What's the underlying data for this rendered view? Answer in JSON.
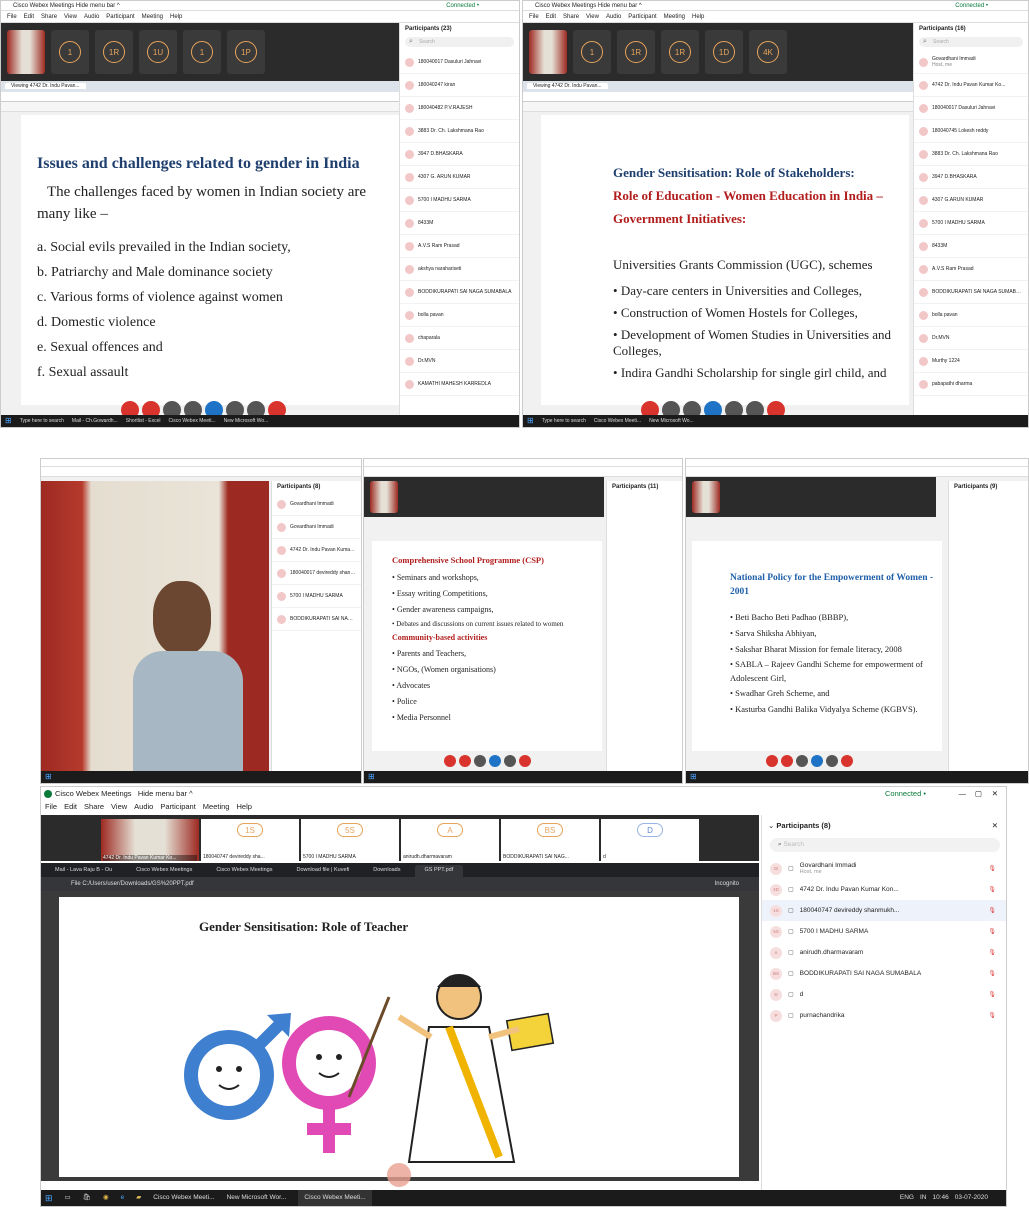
{
  "panel_a": {
    "title": "Cisco Webex Meetings  Hide menu bar ^",
    "connected": "Connected •",
    "menu": [
      "File",
      "Edit",
      "Share",
      "View",
      "Audio",
      "Participant",
      "Meeting",
      "Help"
    ],
    "thumbs": [
      "1",
      "1R",
      "1U",
      "1",
      "1P"
    ],
    "tab": "Viewing 4742 Dr. Indu Pavan...",
    "heading": "Issues and challenges related to gender in India",
    "intro": "The challenges faced by women in Indian society are many like –",
    "items": [
      "a. Social evils prevailed in the Indian society,",
      "b. Patriarchy and Male dominance society",
      "c. Various forms of violence against women",
      "d. Domestic violence",
      "e. Sexual offences and",
      "f. Sexual assault"
    ],
    "participants_header": "Participants (23)",
    "participants": [
      "180040017 Dasuluri Jahnavi",
      "180040247 kiran",
      "180040482 P.V.RAJESH",
      "3883 Dr. Ch. Lakshmana Rao",
      "3947 D.BHASKARA",
      "4307 G. ARUN KUMAR",
      "5700 I MADHU SARMA",
      "8433M",
      "A.V.S Ram Prasad",
      "akshya narahariseti",
      "BODDIKURAPATI SAI NAGA SUMABALA",
      "bolla pavan",
      "chaparala",
      "Dr.MVN",
      "KAMATHI MAHESH KARREDLA"
    ],
    "search": "Search",
    "taskbar": [
      "Type here to search",
      "Mail - Ch.Gowardh...",
      "Shortlist - Excel",
      "Cisco Webex Meeti...",
      "New Microsoft Wo..."
    ]
  },
  "panel_b": {
    "title": "Cisco Webex Meetings  Hide menu bar ^",
    "connected": "Connected •",
    "thumbs": [
      "1",
      "1R",
      "1R",
      "1D",
      "4K"
    ],
    "line1": "Gender Sensitisation:  Role of Stakeholders:",
    "line2": "Role of Education - Women Education in India –",
    "line3": "Government Initiatives:",
    "subhead": "Universities Grants Commission (UGC), schemes",
    "items": [
      "Day-care centers in Universities and Colleges,",
      "Construction of Women Hostels for Colleges,",
      "Development of Women Studies in Universities and Colleges,",
      "Indira Gandhi Scholarship for single girl child, and"
    ],
    "participants_header": "Participants (16)",
    "participants": [
      "Govardhani Immadi",
      "4742 Dr. Indu Pavan Kumar Ko...",
      "180040017 Dasuluri Jahnavi",
      "180040745 Lokesh reddy",
      "3883 Dr. Ch. Lakshmana Rao",
      "3947 D.BHASKARA",
      "4307 G.ARUN KUMAR",
      "5700 I MADHU SARMA",
      "8433M",
      "A.V.S Ram Prasad",
      "BODDIKURAPATI SAI NAGA SUMABALA",
      "bolla pavan",
      "Dr.MVN",
      "Murthy 1224",
      "pabapathi dharma"
    ],
    "host_note": "Host, me"
  },
  "panel_c": {
    "participants_header": "Participants (8)",
    "participants": [
      "Govardhani Immadi",
      "Govardhani Immadi",
      "4742 Dr. Indu Pavan Kumar Ko...",
      "180040017 devireddy shanmukh...",
      "5700 I MADHU SARMA",
      "BODDIKURAPATI SAI NAGA SUMABALA"
    ]
  },
  "panel_d": {
    "heading": "Comprehensive School Programme (CSP)",
    "items1": [
      "Seminars and workshops,",
      "Essay writing Competitions,",
      "Gender awareness campaigns,",
      "Debates and discussions on current issues related to women"
    ],
    "subhead": "Community-based activities",
    "items2": [
      "Parents and Teachers,",
      "NGOs, (Women organisations)",
      "Advocates",
      "Police",
      "Media Personnel"
    ],
    "participants_header": "Participants (11)"
  },
  "panel_e": {
    "heading": "National Policy for the Empowerment of Women - 2001",
    "items": [
      "Beti Bacho Beti Padhao (BBBP),",
      "Sarva Shiksha Abhiyan,",
      "Sakshar Bharat Mission for female literacy, 2008",
      "SABLA – Rajeev Gandhi Scheme for empowerment of Adolescent Girl,",
      "Swadhar Greh Scheme, and",
      "Kasturba Gandhi Balika Vidyalya Scheme (KGBVS)."
    ],
    "participants_header": "Participants (9)"
  },
  "panel_f": {
    "title": "Cisco Webex Meetings",
    "hide_menu": "Hide menu bar ^",
    "connected": "Connected •",
    "menu": [
      "File",
      "Edit",
      "Share",
      "View",
      "Audio",
      "Participant",
      "Meeting",
      "Help"
    ],
    "thumbs": [
      {
        "ini": "",
        "name": "4742 Dr. Indu Pavan Kumar Ko..."
      },
      {
        "ini": "1S",
        "name": "180040747 devireddy sha..."
      },
      {
        "ini": "5S",
        "name": "5700 I MADHU SARMA"
      },
      {
        "ini": "A",
        "name": "anirudh.dharmavaram"
      },
      {
        "ini": "BS",
        "name": "BODDIKURAPATI SAI NAG..."
      },
      {
        "ini": "D",
        "name": "d"
      }
    ],
    "tabs": [
      "Mail - Lava Raju B - Ou",
      "Cisco Webex Meetings",
      "Cisco Webex Meetings",
      "Download file | Kuvefi",
      "Downloads",
      "GS PPT.pdf"
    ],
    "address": "File  C:/Users/user/Downloads/GS%20PPT.pdf",
    "incognito": "Incognito",
    "slide_title": "Gender Sensitisation: Role of Teacher",
    "participants_header": "Participants (8)",
    "search": "Search",
    "participants": [
      {
        "ini": "GI",
        "name": "Govardhani Immadi",
        "sub": "Host, me"
      },
      {
        "ini": "4D",
        "name": "4742 Dr. Indu Pavan Kumar Kon...",
        "sub": ""
      },
      {
        "ini": "1S",
        "name": "180040747 devireddy shanmukh...",
        "sub": ""
      },
      {
        "ini": "5S",
        "name": "5700 I MADHU SARMA",
        "sub": ""
      },
      {
        "ini": "A",
        "name": "anirudh.dharmavaram",
        "sub": ""
      },
      {
        "ini": "BS",
        "name": "BODDIKURAPATI SAI NAGA SUMABALA",
        "sub": ""
      },
      {
        "ini": "D",
        "name": "d",
        "sub": ""
      },
      {
        "ini": "P",
        "name": "purnachandrika",
        "sub": ""
      }
    ],
    "taskbar": [
      "Cisco Webex Meeti...",
      "New Microsoft Wor...",
      "Cisco Webex Meeti..."
    ],
    "lang": "ENG",
    "region": "IN",
    "time": "10:46",
    "date": "03-07-2020"
  }
}
